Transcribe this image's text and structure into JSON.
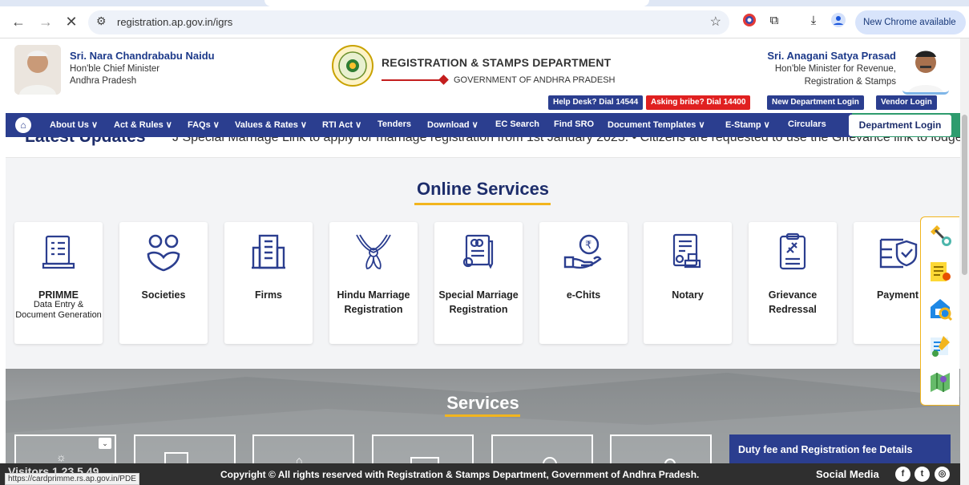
{
  "browser": {
    "url": "registration.ap.gov.in/igrs",
    "new_chrome": "New Chrome available",
    "status_url": "https://cardprimme.rs.ap.gov.in/PDE"
  },
  "header": {
    "cm_name": "Sri. Nara Chandrababu Naidu",
    "cm_title": "Hon'ble Chief Minister",
    "cm_state": "Andhra Pradesh",
    "dept_title": "REGISTRATION & STAMPS DEPARTMENT",
    "govt_title": "GOVERNMENT OF ANDHRA PRADESH",
    "minister_name": "Sri. Anagani Satya Prasad",
    "minister_title": "Hon'ble Minister for Revenue,",
    "minister_dept": "Registration & Stamps",
    "help_desk": "Help Desk? Dial 14544",
    "bribe": "Asking bribe? Dial 14400",
    "new_dept_login": "New Department Login",
    "vendor_login": "Vendor Login"
  },
  "nav": {
    "items": [
      "About Us ∨",
      "Act & Rules ∨",
      "FAQs ∨",
      "Values & Rates ∨",
      "RTI Act ∨",
      "Tenders",
      "Download ∨",
      "EC Search",
      "Find SRO",
      "Document Templates ∨",
      "E-Stamp ∨",
      "Circulars"
    ],
    "department_login": "Department Login"
  },
  "ticker": {
    "label": "Latest Updates",
    "message": "J Special Marriage Link to apply for marriage registration from 1st January 2025.   •  Citizens are requested to use the Grievance link to lodge"
  },
  "online_services": {
    "title": "Online Services",
    "cards": [
      {
        "title": "PRIMME",
        "subtitle": "Data Entry & Document Generation"
      },
      {
        "title": "Societies"
      },
      {
        "title": "Firms"
      },
      {
        "title": "Hindu Marriage Registration"
      },
      {
        "title": "Special Marriage Registration"
      },
      {
        "title": "e-Chits"
      },
      {
        "title": "Notary"
      },
      {
        "title": "Grievance Redressal"
      },
      {
        "title": "Payment"
      }
    ]
  },
  "services": {
    "title": "Services",
    "duty_fee": "Duty fee and Registration fee Details"
  },
  "footer": {
    "visitors": "Visitors 1,23,5,49",
    "copyright": "Copyright © All rights reserved with Registration & Stamps Department, Government of Andhra Pradesh.",
    "social": "Social Media"
  },
  "colors": {
    "brand_blue": "#2b3e8f",
    "accent_yellow": "#f2b51e",
    "alert_red": "#e02020"
  }
}
